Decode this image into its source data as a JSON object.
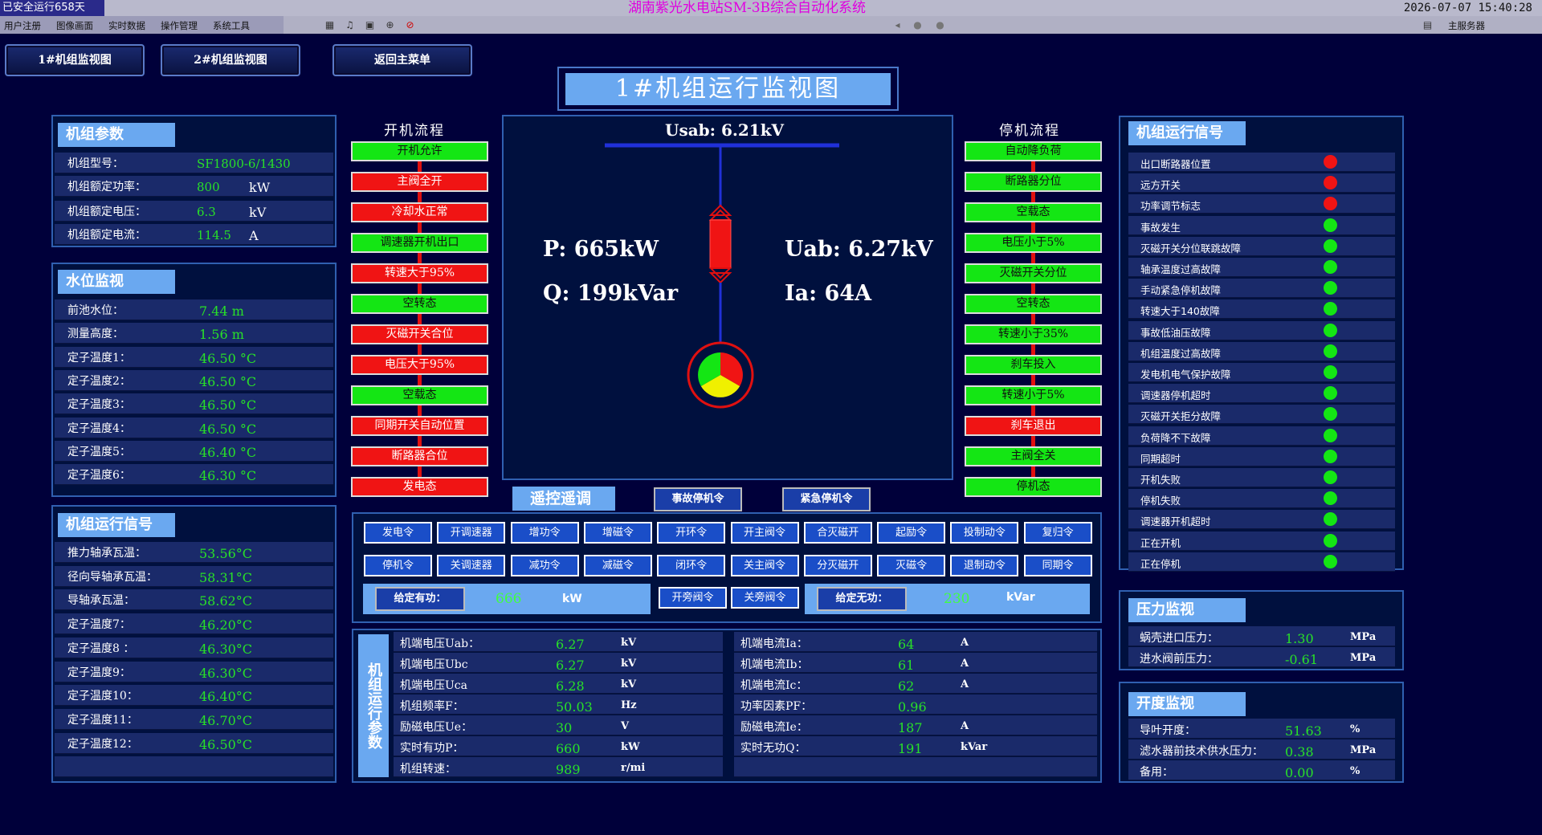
{
  "system": {
    "safe_running": "已安全运行658天",
    "title": "湖南紫光水电站SM-3B综合自动化系统",
    "datetime": "2026-07-07  15:40:28",
    "server": "主服务器"
  },
  "menu": [
    "用户注册",
    "图像画面",
    "实时数据",
    "操作管理",
    "系统工具"
  ],
  "nav": {
    "unit1": "1#机组监视图",
    "unit2": "2#机组监视图",
    "back": "返回主菜单"
  },
  "page_title": "1#机组运行监视图",
  "unit_params": {
    "title": "机组参数",
    "rows": [
      {
        "label": "机组型号：",
        "value": "SF1800-6/1430",
        "unit": ""
      },
      {
        "label": "机组额定功率：",
        "value": "800",
        "unit": "kW"
      },
      {
        "label": "机组额定电压：",
        "value": "6.3",
        "unit": "kV"
      },
      {
        "label": "机组额定电流：",
        "value": "114.5",
        "unit": "A"
      }
    ]
  },
  "water_monitor": {
    "title": "水位监视",
    "rows": [
      {
        "label": "前池水位：",
        "value": "7.44 m"
      },
      {
        "label": "测量高度：",
        "value": "1.56 m"
      },
      {
        "label": "定子温度1：",
        "value": "46.50 °C"
      },
      {
        "label": "定子温度2：",
        "value": "46.50 °C"
      },
      {
        "label": "定子温度3：",
        "value": "46.50 °C"
      },
      {
        "label": "定子温度4：",
        "value": "46.50 °C"
      },
      {
        "label": "定子温度5：",
        "value": "46.40 °C"
      },
      {
        "label": "定子温度6：",
        "value": "46.30 °C"
      }
    ]
  },
  "run_signal_left": {
    "title": "机组运行信号",
    "rows": [
      {
        "label": "推力轴承瓦温：",
        "value": "53.56°C"
      },
      {
        "label": "径向导轴承瓦温：",
        "value": "58.31°C"
      },
      {
        "label": "导轴承瓦温：",
        "value": "58.62°C"
      },
      {
        "label": "定子温度7：",
        "value": "46.20°C"
      },
      {
        "label": "定子温度8 ：",
        "value": "46.30°C"
      },
      {
        "label": "定子温度9：",
        "value": "46.30°C"
      },
      {
        "label": "定子温度10：",
        "value": "46.40°C"
      },
      {
        "label": "定子温度11：",
        "value": "46.70°C"
      },
      {
        "label": "定子温度12：",
        "value": "46.50°C"
      }
    ]
  },
  "start_flow": {
    "title": "开机流程",
    "steps": [
      {
        "label": "开机允许",
        "state": "green"
      },
      {
        "label": "主阀全开",
        "state": "red"
      },
      {
        "label": "冷却水正常",
        "state": "red"
      },
      {
        "label": "调速器开机出口",
        "state": "green"
      },
      {
        "label": "转速大于95%",
        "state": "red"
      },
      {
        "label": "空转态",
        "state": "green"
      },
      {
        "label": "灭磁开关合位",
        "state": "red"
      },
      {
        "label": "电压大于95%",
        "state": "red"
      },
      {
        "label": "空载态",
        "state": "green"
      },
      {
        "label": "同期开关自动位置",
        "state": "red"
      },
      {
        "label": "断路器合位",
        "state": "red"
      },
      {
        "label": "发电态",
        "state": "red"
      }
    ]
  },
  "stop_flow": {
    "title": "停机流程",
    "steps": [
      {
        "label": "自动降负荷",
        "state": "green"
      },
      {
        "label": "断路器分位",
        "state": "green"
      },
      {
        "label": "空载态",
        "state": "green"
      },
      {
        "label": "电压小于5%",
        "state": "green"
      },
      {
        "label": "灭磁开关分位",
        "state": "green"
      },
      {
        "label": "空转态",
        "state": "green"
      },
      {
        "label": "转速小于35%",
        "state": "green"
      },
      {
        "label": "刹车投入",
        "state": "green"
      },
      {
        "label": "转速小于5%",
        "state": "green"
      },
      {
        "label": "刹车退出",
        "state": "red"
      },
      {
        "label": "主阀全关",
        "state": "green"
      },
      {
        "label": "停机态",
        "state": "green"
      }
    ]
  },
  "diagram": {
    "usab": "Usab: 6.21kV",
    "p": "P: 665kW",
    "q": "Q: 199kVar",
    "uab": "Uab: 6.27kV",
    "ia": "Ia: 64A"
  },
  "remote": {
    "title": "遥控遥调",
    "accident_stop": "事故停机令",
    "emergency_stop": "紧急停机令",
    "row1": [
      "发电令",
      "开调速器",
      "增功令",
      "增磁令",
      "开环令",
      "开主阀令",
      "合灭磁开",
      "起励令",
      "投制动令",
      "复归令"
    ],
    "row2": [
      "停机令",
      "关调速器",
      "减功令",
      "减磁令",
      "闭环令",
      "关主阀令",
      "分灭磁开",
      "灭磁令",
      "退制动令",
      "同期令"
    ],
    "set_active_label": "给定有功：",
    "set_active_value": "666",
    "set_active_unit": "kW",
    "open_bypass": "开旁阀令",
    "close_bypass": "关旁阀令",
    "set_reactive_label": "给定无功：",
    "set_reactive_value": "230",
    "set_reactive_unit": "kVar"
  },
  "run_params": {
    "title": "机组运行参数",
    "left": [
      {
        "label": "机端电压Uab：",
        "value": "6.27",
        "unit": "kV"
      },
      {
        "label": "机端电压Ubc",
        "value": "6.27",
        "unit": "kV"
      },
      {
        "label": "机端电压Uca",
        "value": "6.28",
        "unit": "kV"
      },
      {
        "label": "机组频率F：",
        "value": "50.03",
        "unit": "Hz"
      },
      {
        "label": "励磁电压Ue：",
        "value": "30",
        "unit": "V"
      },
      {
        "label": "实时有功P：",
        "value": "660",
        "unit": "kW"
      },
      {
        "label": "机组转速：",
        "value": "989",
        "unit": "r/mi"
      }
    ],
    "right": [
      {
        "label": "机端电流Ia：",
        "value": "64",
        "unit": "A"
      },
      {
        "label": "机端电流Ib：",
        "value": "61",
        "unit": "A"
      },
      {
        "label": "机端电流Ic：",
        "value": "62",
        "unit": "A"
      },
      {
        "label": "功率因素PF：",
        "value": "0.96",
        "unit": ""
      },
      {
        "label": "励磁电流Ie：",
        "value": "187",
        "unit": "A"
      },
      {
        "label": "实时无功Q：",
        "value": "191",
        "unit": "kVar"
      },
      {
        "label": "",
        "value": "",
        "unit": ""
      }
    ]
  },
  "run_signal_right": {
    "title": "机组运行信号",
    "rows": [
      {
        "label": "出口断路器位置",
        "color": "#f01414"
      },
      {
        "label": "远方开关",
        "color": "#f01414"
      },
      {
        "label": "功率调节标志",
        "color": "#f01414"
      },
      {
        "label": "事故发生",
        "color": "#14e614"
      },
      {
        "label": "灭磁开关分位联跳故障",
        "color": "#14e614"
      },
      {
        "label": "轴承温度过高故障",
        "color": "#14e614"
      },
      {
        "label": "手动紧急停机故障",
        "color": "#14e614"
      },
      {
        "label": "转速大于140故障",
        "color": "#14e614"
      },
      {
        "label": "事故低油压故障",
        "color": "#14e614"
      },
      {
        "label": "机组温度过高故障",
        "color": "#14e614"
      },
      {
        "label": "发电机电气保护故障",
        "color": "#14e614"
      },
      {
        "label": "调速器停机超时",
        "color": "#14e614"
      },
      {
        "label": "灭磁开关拒分故障",
        "color": "#14e614"
      },
      {
        "label": "负荷降不下故障",
        "color": "#14e614"
      },
      {
        "label": "同期超时",
        "color": "#14e614"
      },
      {
        "label": "开机失败",
        "color": "#14e614"
      },
      {
        "label": "停机失败",
        "color": "#14e614"
      },
      {
        "label": "调速器开机超时",
        "color": "#14e614"
      },
      {
        "label": "正在开机",
        "color": "#14e614"
      },
      {
        "label": "正在停机",
        "color": "#14e614"
      }
    ]
  },
  "pressure": {
    "title": "压力监视",
    "rows": [
      {
        "label": "蜗壳进口压力：",
        "value": "1.30",
        "unit": "MPa"
      },
      {
        "label": "进水阀前压力：",
        "value": "-0.61",
        "unit": "MPa"
      }
    ]
  },
  "opening": {
    "title": "开度监视",
    "rows": [
      {
        "label": "导叶开度：",
        "value": "51.63",
        "unit": "%"
      },
      {
        "label": "滤水器前技术供水压力：",
        "value": "0.38",
        "unit": "MPa"
      },
      {
        "label": "备用：",
        "value": "0.00",
        "unit": "%"
      }
    ]
  }
}
